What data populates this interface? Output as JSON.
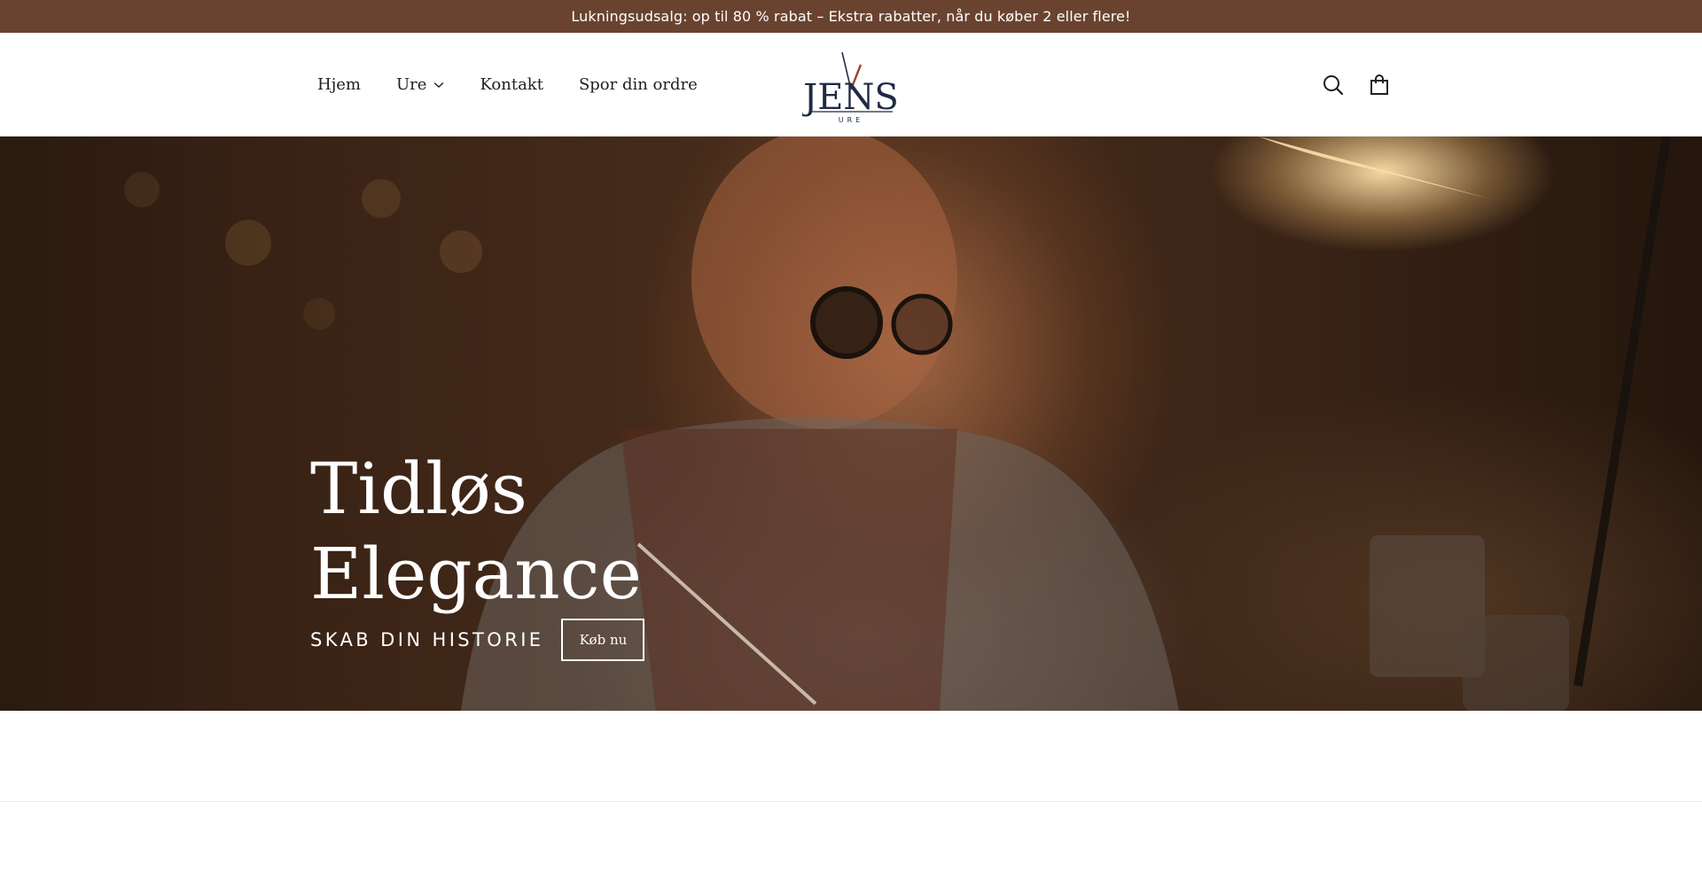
{
  "announcement": {
    "text": "Lukningsudsalg: op til 80 % rabat – Ekstra rabatter, når du køber 2 eller flere!"
  },
  "nav": {
    "items": [
      {
        "label": "Hjem"
      },
      {
        "label": "Ure",
        "has_dropdown": true
      },
      {
        "label": "Kontakt"
      },
      {
        "label": "Spor din ordre"
      }
    ]
  },
  "logo": {
    "text": "JENS",
    "subtext": "URE"
  },
  "header_icons": [
    "search-icon",
    "cart-icon"
  ],
  "hero": {
    "title_line1": "Tidløs",
    "title_line2": "Elegance",
    "subtitle": "SKAB DIN HISTORIE",
    "button_label": "Køb nu"
  },
  "colors": {
    "announcement_bg": "#6a4330",
    "logo_navy": "#1f2a44",
    "logo_accent": "#a0452a"
  }
}
